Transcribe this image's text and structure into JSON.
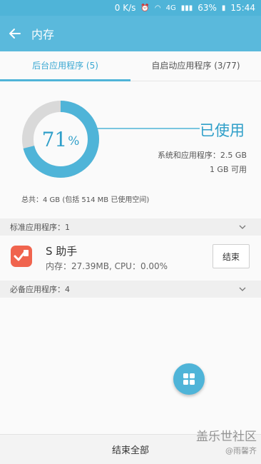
{
  "status_bar": {
    "net_speed": "0 K/s",
    "network": "4G",
    "battery": "63%",
    "time": "15:44"
  },
  "app_bar": {
    "title": "内存"
  },
  "tabs": [
    {
      "label": "后台应用程序 (5)",
      "active": true
    },
    {
      "label": "自启动应用程序 (3/77)",
      "active": false
    }
  ],
  "memory": {
    "percent_value": 71,
    "percent_number": "71",
    "percent_sign": "%",
    "used_label": "已使用",
    "system_apps": "系统和应用程序：2.5 GB",
    "available": "1 GB 可用",
    "total": "总共：4 GB (包括 514 MB 已使用空间)"
  },
  "sections": {
    "standard": "标准应用程序：1",
    "essential": "必备应用程序：4"
  },
  "apps": [
    {
      "name": "S 助手",
      "detail": "内存：27.39MB, CPU：0.00%",
      "button": "结束"
    }
  ],
  "bottom_button": "结束全部",
  "watermark": {
    "line1": "盖乐世社区",
    "line2": "@雨馨齐"
  },
  "colors": {
    "accent": "#4fb4d8",
    "donut_track": "#d9d9d9",
    "app_icon": "#f0644e"
  }
}
